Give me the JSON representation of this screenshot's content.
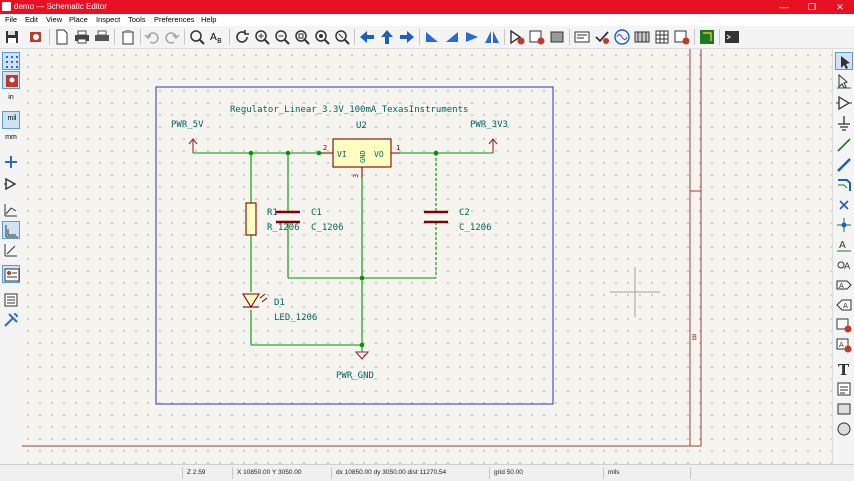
{
  "window": {
    "title": "demo — Schematic Editor",
    "controls": [
      "—",
      "❐",
      "✕"
    ]
  },
  "menu": [
    "File",
    "Edit",
    "View",
    "Place",
    "Inspect",
    "Tools",
    "Preferences",
    "Help"
  ],
  "schematic": {
    "block_title": "Regulator_Linear_3.3V_100mA_TexasInstruments",
    "u2": {
      "ref": "U2",
      "pin_in": "VI",
      "pin_out": "VO",
      "pin_gnd": "GND",
      "pin_num_in": "2",
      "pin_num_out": "1",
      "pin_num_gnd": "3"
    },
    "power": {
      "in": "PWR_5V",
      "out": "PWR_3V3",
      "gnd": "PWR_GND"
    },
    "r1": {
      "ref": "R1",
      "footprint": "R_1206"
    },
    "c1": {
      "ref": "C1",
      "footprint": "C_1206"
    },
    "c2": {
      "ref": "C2",
      "footprint": "C_1206"
    },
    "d1": {
      "ref": "D1",
      "footprint": "LED_1206"
    },
    "border_label": "B"
  },
  "left_toolbar": {
    "in_label": "in",
    "mil_label": "mil",
    "mm_label": "mm"
  },
  "status": {
    "zoom": "Z 2.59",
    "cursor": "X 10850.00  Y 3050.00",
    "delta": "dx 10850.00  dy 3050.00  dist 11270.54",
    "grid": "grid 50.00",
    "units": "mils"
  },
  "colors": {
    "title_bar": "#e81123",
    "wire": "#009600",
    "power_symbol": "#a52a2a",
    "symbol_body": "#ffffc2",
    "symbol_outline": "#840000",
    "label_text": "#006464",
    "sheet_frame": "#3030c0",
    "page_border": "#a04040"
  }
}
